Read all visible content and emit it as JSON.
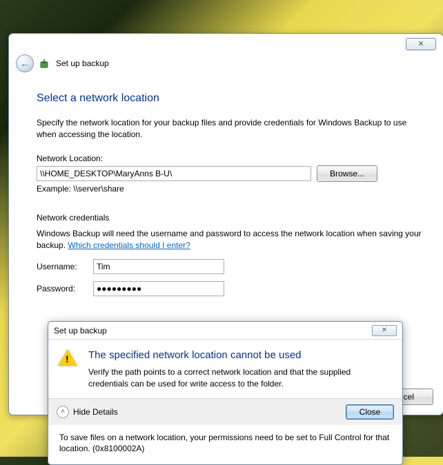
{
  "outer": {
    "title": "Set up backup",
    "heading": "Select a network location",
    "intro": "Specify the network location for your backup files and provide credentials for Windows Backup to use when accessing the location.",
    "location_label": "Network Location:",
    "location_value": "\\\\HOME_DESKTOP\\MaryAnns B-U\\",
    "browse_label": "Browse...",
    "example": "Example: \\\\server\\share",
    "creds_heading": "Network credentials",
    "creds_text": "Windows Backup will need the username and password to access the network location when saving your backup. ",
    "creds_link": "Which credentials should I enter?",
    "username_label": "Username:",
    "username_value": "Tim",
    "password_label": "Password:",
    "password_value": "●●●●●●●●●",
    "cancel_label": "ncel"
  },
  "inner": {
    "title": "Set up backup",
    "heading": "The specified network location cannot be used",
    "body": "Verify the path points to a correct network location and that the supplied credentials can be used for write access to the folder.",
    "hide_label": "Hide Details",
    "close_label": "Close",
    "details": "To save files on a network location, your permissions need to be set to Full Control for that location. (0x8100002A)"
  }
}
